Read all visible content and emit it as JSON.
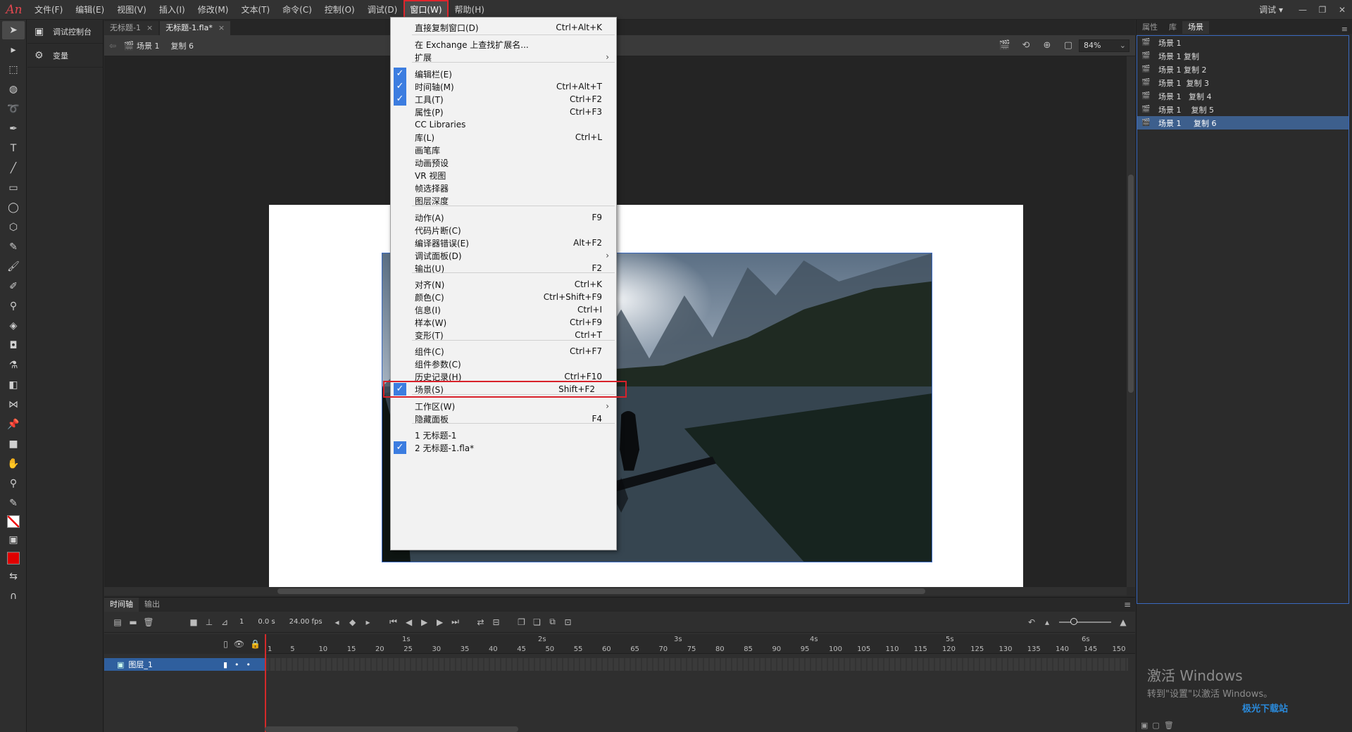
{
  "app": {
    "logo": "An",
    "workspace": "调试",
    "workspace_arrow": "▾"
  },
  "menubar": [
    "文件(F)",
    "编辑(E)",
    "视图(V)",
    "插入(I)",
    "修改(M)",
    "文本(T)",
    "命令(C)",
    "控制(O)",
    "调试(D)",
    "窗口(W)",
    "帮助(H)"
  ],
  "side_panel": [
    {
      "icon": "monitor-icon",
      "label": "调试控制台"
    },
    {
      "icon": "gears-icon",
      "label": "变量"
    }
  ],
  "doc_tabs": [
    {
      "label": "无标题-1",
      "close": "×"
    },
    {
      "label": "无标题-1.fla*",
      "close": "×"
    }
  ],
  "edit_bar": {
    "scene": "场景 1",
    "symbol": "复制 6",
    "zoom": "84%"
  },
  "window_menu": {
    "items": [
      {
        "label": "直接复制窗口(D)",
        "shortcut": "Ctrl+Alt+K",
        "checked": false,
        "submenu": false
      },
      {
        "label": "在 Exchange 上查找扩展名...",
        "shortcut": "",
        "checked": false,
        "submenu": false
      },
      {
        "label": "扩展",
        "shortcut": "",
        "checked": false,
        "submenu": true
      },
      {
        "label": "编辑栏(E)",
        "shortcut": "",
        "checked": true,
        "submenu": false
      },
      {
        "label": "时间轴(M)",
        "shortcut": "Ctrl+Alt+T",
        "checked": true,
        "submenu": false
      },
      {
        "label": "工具(T)",
        "shortcut": "Ctrl+F2",
        "checked": true,
        "submenu": false
      },
      {
        "label": "属性(P)",
        "shortcut": "Ctrl+F3",
        "checked": false,
        "submenu": false
      },
      {
        "label": "CC Libraries",
        "shortcut": "",
        "checked": false,
        "submenu": false
      },
      {
        "label": "库(L)",
        "shortcut": "Ctrl+L",
        "checked": false,
        "submenu": false
      },
      {
        "label": "画笔库",
        "shortcut": "",
        "checked": false,
        "submenu": false
      },
      {
        "label": "动画预设",
        "shortcut": "",
        "checked": false,
        "submenu": false
      },
      {
        "label": "VR 视图",
        "shortcut": "",
        "checked": false,
        "submenu": false
      },
      {
        "label": "帧选择器",
        "shortcut": "",
        "checked": false,
        "submenu": false
      },
      {
        "label": "图层深度",
        "shortcut": "",
        "checked": false,
        "submenu": false
      },
      {
        "label": "动作(A)",
        "shortcut": "F9",
        "checked": false,
        "submenu": false
      },
      {
        "label": "代码片断(C)",
        "shortcut": "",
        "checked": false,
        "submenu": false
      },
      {
        "label": "编译器错误(E)",
        "shortcut": "Alt+F2",
        "checked": false,
        "submenu": false
      },
      {
        "label": "调试面板(D)",
        "shortcut": "",
        "checked": false,
        "submenu": true
      },
      {
        "label": "输出(U)",
        "shortcut": "F2",
        "checked": false,
        "submenu": false
      },
      {
        "label": "对齐(N)",
        "shortcut": "Ctrl+K",
        "checked": false,
        "submenu": false
      },
      {
        "label": "颜色(C)",
        "shortcut": "Ctrl+Shift+F9",
        "checked": false,
        "submenu": false
      },
      {
        "label": "信息(I)",
        "shortcut": "Ctrl+I",
        "checked": false,
        "submenu": false
      },
      {
        "label": "样本(W)",
        "shortcut": "Ctrl+F9",
        "checked": false,
        "submenu": false
      },
      {
        "label": "变形(T)",
        "shortcut": "Ctrl+T",
        "checked": false,
        "submenu": false
      },
      {
        "label": "组件(C)",
        "shortcut": "Ctrl+F7",
        "checked": false,
        "submenu": false
      },
      {
        "label": "组件参数(C)",
        "shortcut": "",
        "checked": false,
        "submenu": false
      },
      {
        "label": "历史记录(H)",
        "shortcut": "Ctrl+F10",
        "checked": false,
        "submenu": false
      },
      {
        "label": "场景(S)",
        "shortcut": "Shift+F2",
        "checked": true,
        "submenu": false,
        "highlighted": true
      },
      {
        "label": "工作区(W)",
        "shortcut": "",
        "checked": false,
        "submenu": true
      },
      {
        "label": "隐藏面板",
        "shortcut": "F4",
        "checked": false,
        "submenu": false
      },
      {
        "label": "1 无标题-1",
        "shortcut": "",
        "checked": false,
        "submenu": false
      },
      {
        "label": "2 无标题-1.fla*",
        "shortcut": "",
        "checked": true,
        "submenu": false
      }
    ]
  },
  "timeline": {
    "tabs": [
      "时间轴",
      "输出"
    ],
    "frame": "1",
    "time": "0.0 s",
    "fps": "24.00 fps",
    "seconds": [
      "1s",
      "2s",
      "3s",
      "4s",
      "5s",
      "6s"
    ],
    "frame_numbers": [
      "1",
      "5",
      "10",
      "15",
      "20",
      "25",
      "30",
      "35",
      "40",
      "45",
      "50",
      "55",
      "60",
      "65",
      "70",
      "75",
      "80",
      "85",
      "90",
      "95",
      "100",
      "105",
      "110",
      "115",
      "120",
      "125",
      "130",
      "135",
      "140",
      "145",
      "150"
    ],
    "layer_name": "图层_1"
  },
  "right_panel": {
    "tabs": [
      "属性",
      "库",
      "场景"
    ],
    "scenes": [
      "场景 1",
      "场景 1 复制",
      "场景 1 复制 2",
      "场景 1  复制 3",
      "场景 1   复制 4",
      "场景 1    复制 5",
      "场景 1     复制 6"
    ],
    "selected_index": 6
  },
  "watermark": {
    "line1": "激活 Windows",
    "line2": "转到\"设置\"以激活 Windows。",
    "site": "极光下载站"
  }
}
